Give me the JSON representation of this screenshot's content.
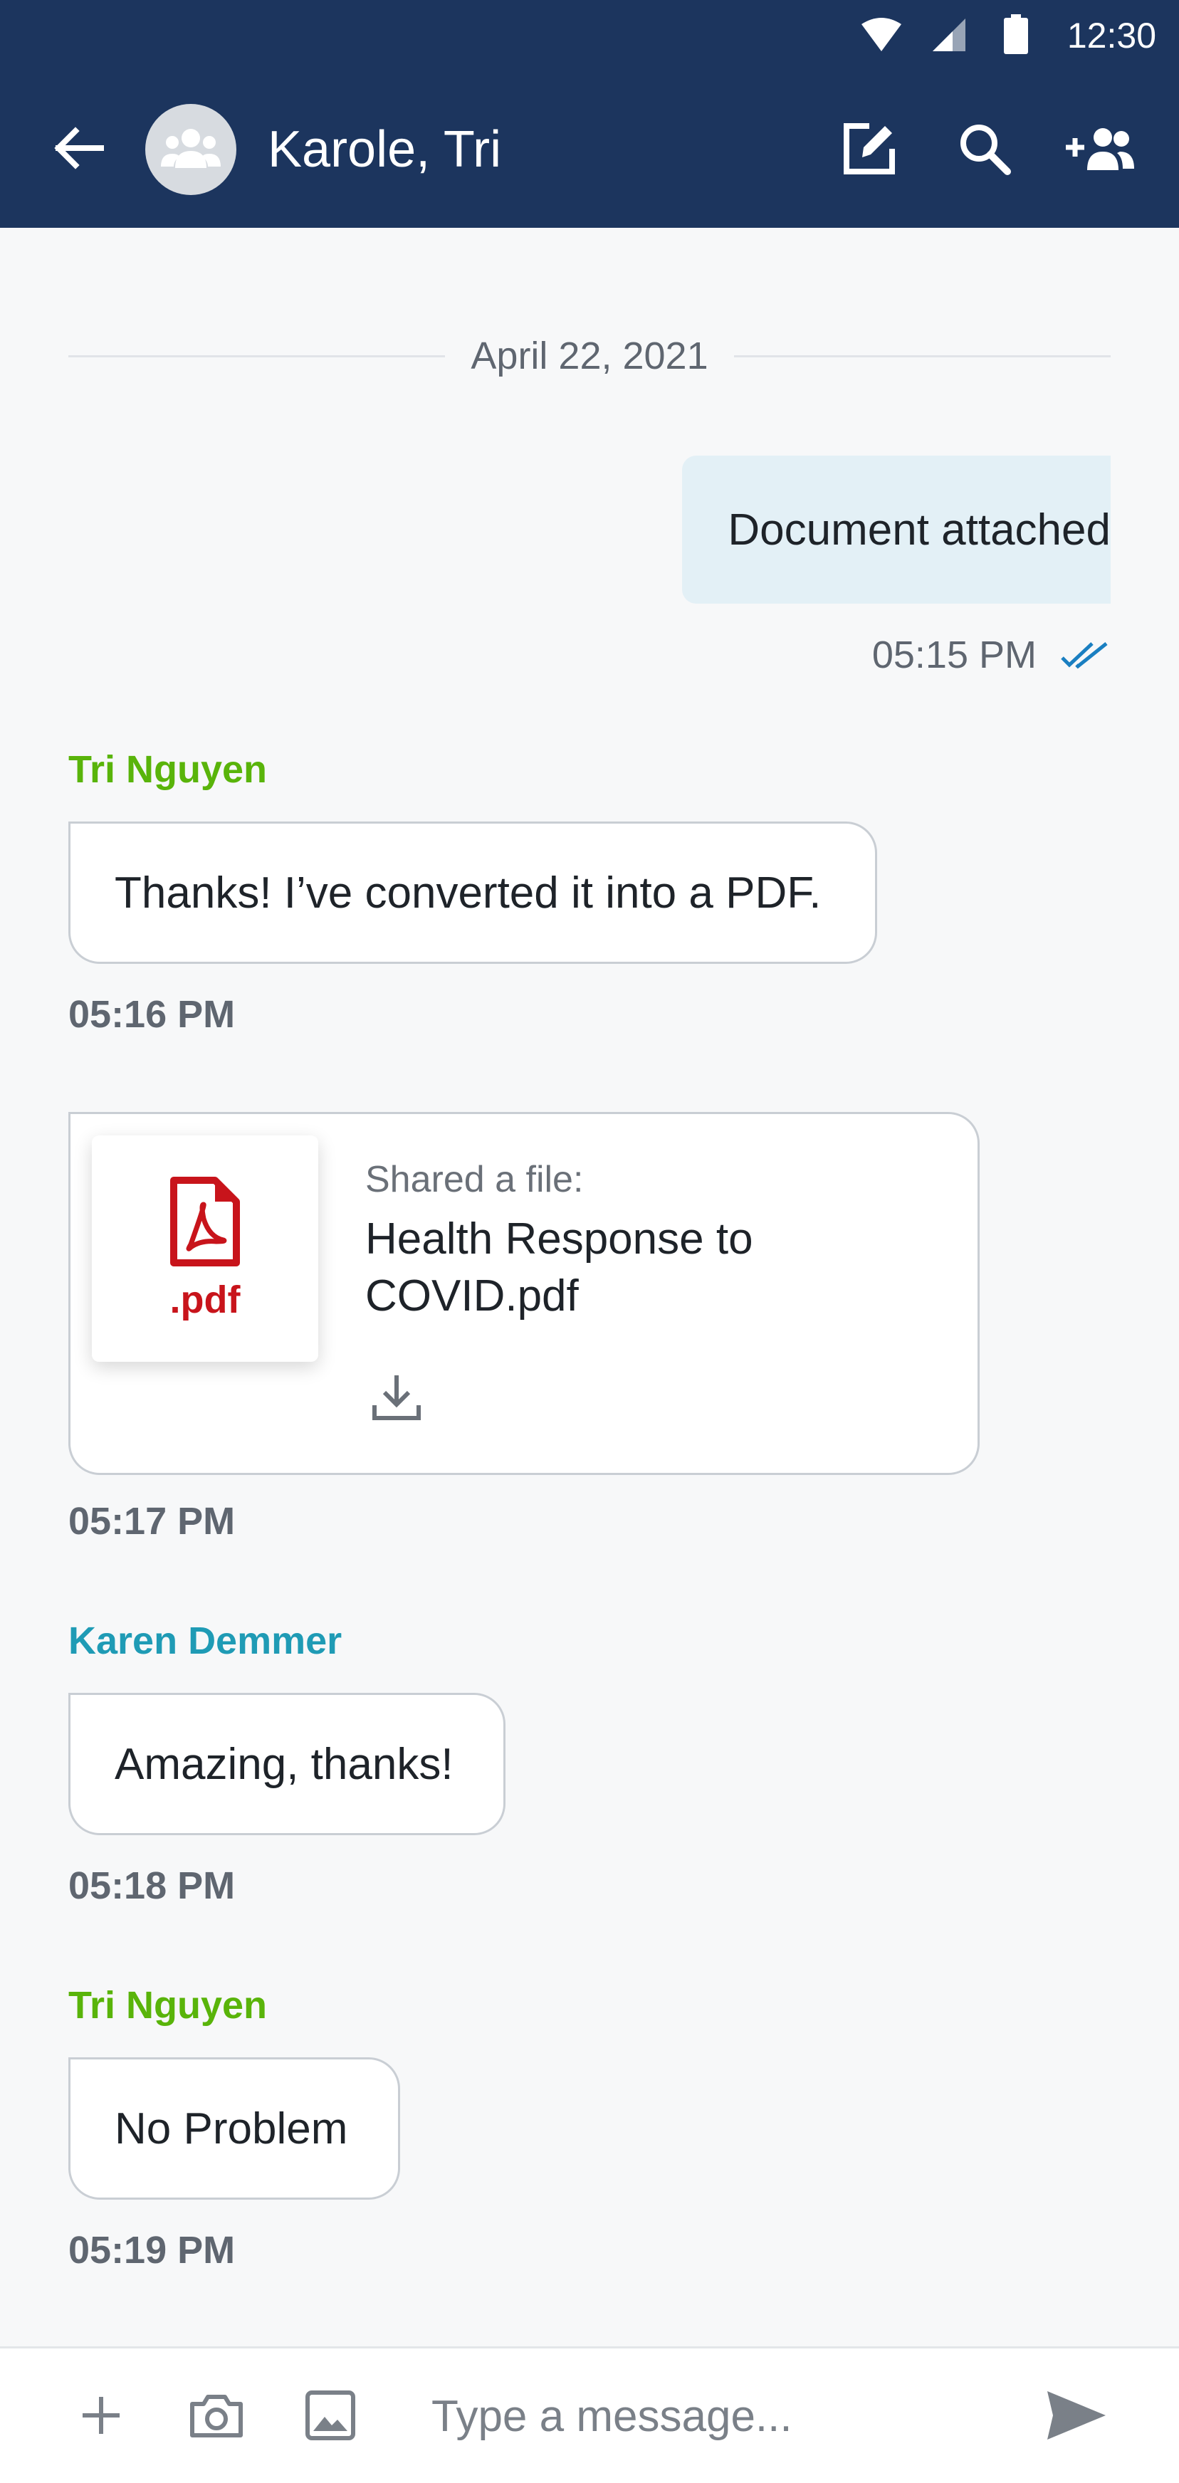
{
  "status_bar": {
    "time": "12:30",
    "icons": [
      "wifi-icon",
      "signal-icon",
      "battery-icon"
    ]
  },
  "header": {
    "title": "Karole, Tri",
    "back_icon": "arrow-left-icon",
    "avatar_icon": "group-icon",
    "actions": [
      "edit-icon",
      "search-icon",
      "add-people-icon"
    ]
  },
  "messages": {
    "date_separator": "April 22, 2021",
    "outgoing": {
      "text": "Document attached",
      "time": "05:15 PM",
      "status_icon": "double-check-icon"
    },
    "msg1": {
      "sender": "Tri Nguyen",
      "text": "Thanks! I’ve converted it into a PDF.",
      "time": "05:16 PM"
    },
    "file_msg": {
      "label": "Shared a file:",
      "file_name": "Health Response to COVID.pdf",
      "ext": ".pdf",
      "file_icon": "pdf-file-icon",
      "download_icon": "download-icon",
      "time": "05:17 PM"
    },
    "msg2": {
      "sender": "Karen Demmer",
      "text": "Amazing, thanks!",
      "time": "05:18 PM"
    },
    "msg3": {
      "sender": "Tri Nguyen",
      "text": "No Problem",
      "time": "05:19 PM"
    }
  },
  "composer": {
    "placeholder": "Type a message...",
    "icons": [
      "plus-icon",
      "camera-icon",
      "image-icon",
      "send-icon"
    ]
  },
  "colors": {
    "header_bg": "#1c355e",
    "sender_green": "#59b40a",
    "sender_teal": "#1f9bb5",
    "outgoing_bubble": "#e3f0f6",
    "read_check": "#1a7fc1",
    "pdf_red": "#c8141b"
  }
}
